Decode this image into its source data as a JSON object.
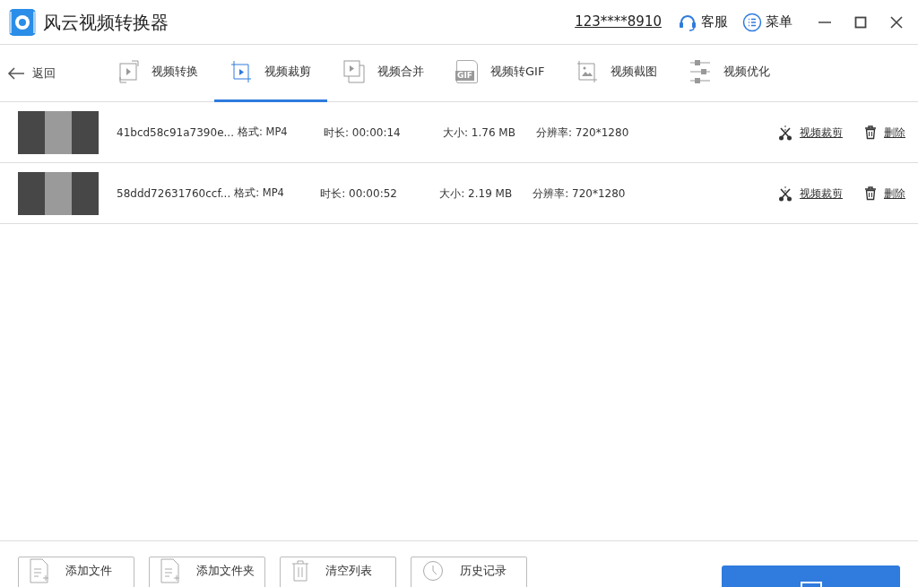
{
  "window": {
    "title": "风云视频转换器",
    "account": "123****8910",
    "service": "客服",
    "menu": "菜单"
  },
  "back": "返回",
  "tabs": [
    {
      "label": "视频转换",
      "kind": "convert",
      "selected": false
    },
    {
      "label": "视频裁剪",
      "kind": "crop",
      "selected": true
    },
    {
      "label": "视频合并",
      "kind": "merge",
      "selected": false
    },
    {
      "label": "视频转GIF",
      "kind": "gif",
      "icon_text": "GIF",
      "selected": false
    },
    {
      "label": "视频截图",
      "kind": "screenshot",
      "selected": false
    },
    {
      "label": "视频优化",
      "kind": "optimize",
      "selected": false
    }
  ],
  "files": [
    {
      "name": "41bcd58c91a7390e...",
      "format": "格式: MP4",
      "duration": "时长: 00:00:14",
      "size": "大小: 1.76 MB",
      "resolution": "分辨率: 720*1280",
      "crop": "视频裁剪",
      "delete": "删除"
    },
    {
      "name": "58ddd72631760ccf...",
      "format": "格式: MP4",
      "duration": "时长: 00:00:52",
      "size": "大小: 2.19 MB",
      "resolution": "分辨率: 720*1280",
      "crop": "视频裁剪",
      "delete": "删除"
    }
  ],
  "footer_buttons": [
    {
      "label": "添加文件",
      "kind": "file"
    },
    {
      "label": "添加文件夹",
      "kind": "folder"
    },
    {
      "label": "清空列表",
      "kind": "clear"
    },
    {
      "label": "历史记录",
      "kind": "history"
    }
  ]
}
